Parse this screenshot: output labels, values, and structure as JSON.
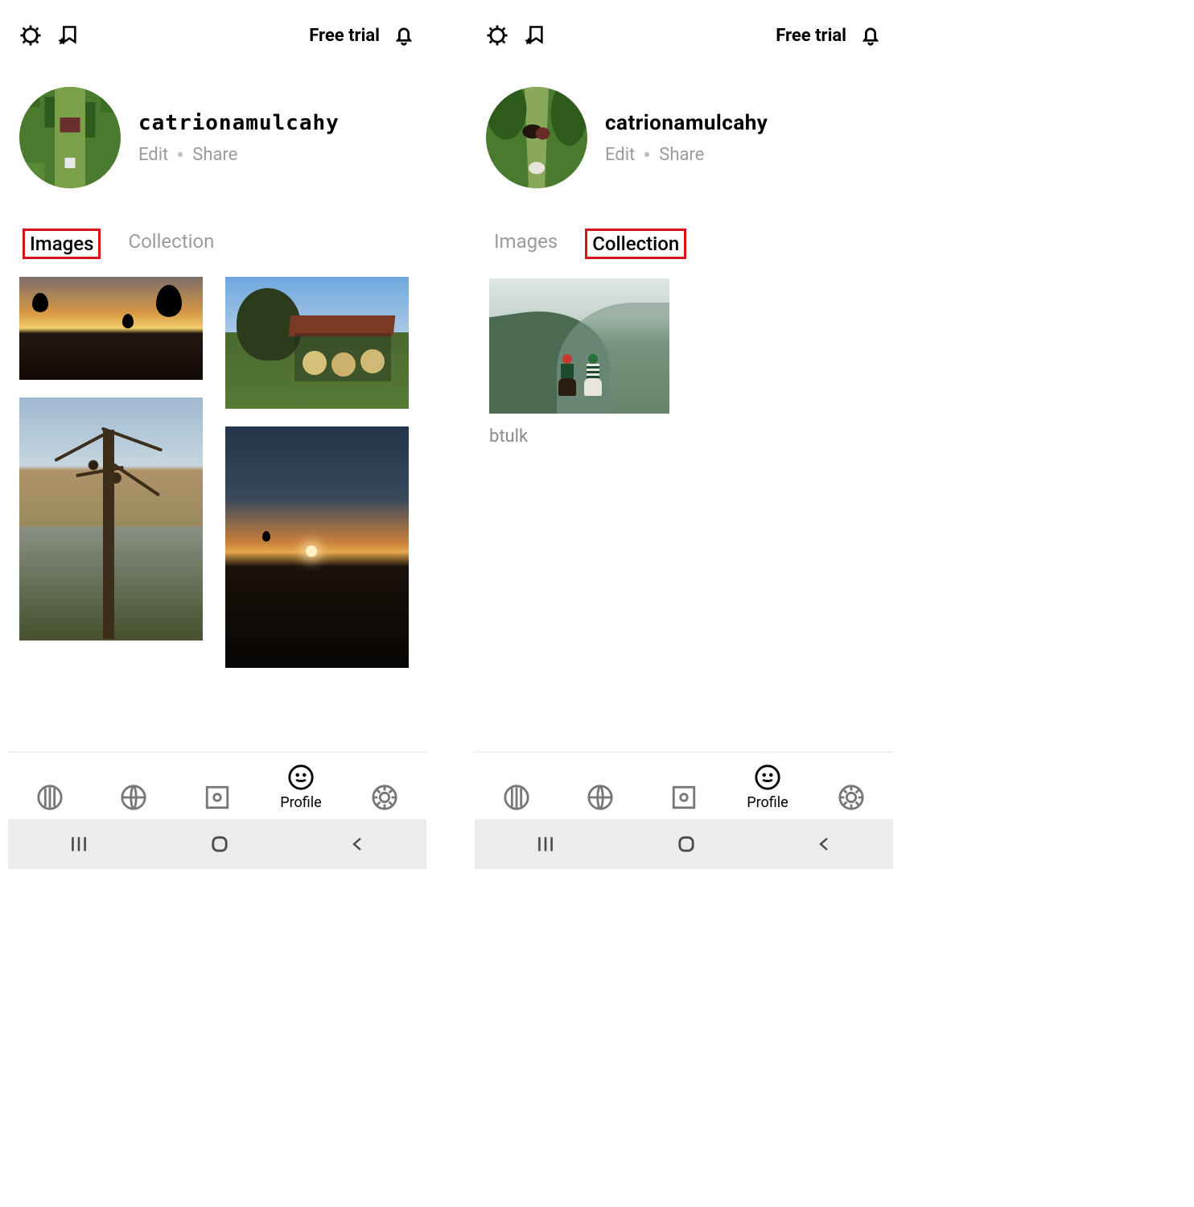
{
  "left": {
    "topbar": {
      "free_trial": "Free trial"
    },
    "profile": {
      "username": "catrionamulcahy",
      "edit": "Edit",
      "share": "Share"
    },
    "tabs": {
      "images": "Images",
      "collection": "Collection",
      "active": "images"
    },
    "bottomnav": {
      "profile": "Profile"
    }
  },
  "right": {
    "topbar": {
      "free_trial": "Free trial"
    },
    "profile": {
      "username": "catrionamulcahy",
      "edit": "Edit",
      "share": "Share"
    },
    "tabs": {
      "images": "Images",
      "collection": "Collection",
      "active": "collection"
    },
    "collection": {
      "items": [
        {
          "label": "btulk"
        }
      ]
    },
    "bottomnav": {
      "profile": "Profile"
    }
  }
}
